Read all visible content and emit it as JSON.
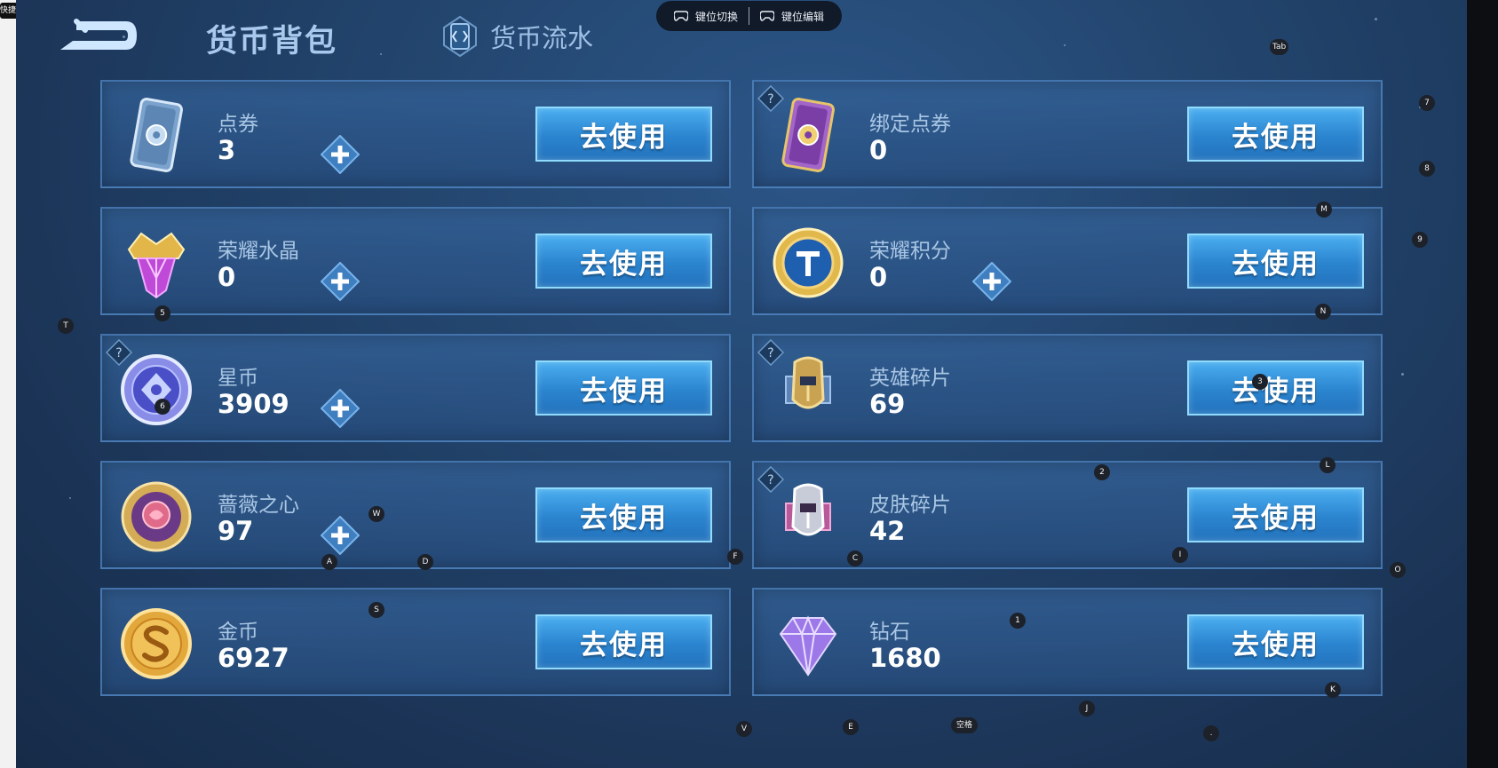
{
  "page": {
    "title": "货币背包",
    "flow_tab": "货币流水",
    "use_label": "去使用"
  },
  "toolbar": {
    "switch_label": "键位切换",
    "edit_label": "键位编辑"
  },
  "shortcut_tag": "快捷方式",
  "currencies": [
    {
      "name": "点券",
      "value": "3"
    },
    {
      "name": "绑定点券",
      "value": "0"
    },
    {
      "name": "荣耀水晶",
      "value": "0"
    },
    {
      "name": "荣耀积分",
      "value": "0"
    },
    {
      "name": "星币",
      "value": "3909"
    },
    {
      "name": "英雄碎片",
      "value": "69"
    },
    {
      "name": "蔷薇之心",
      "value": "97"
    },
    {
      "name": "皮肤碎片",
      "value": "42"
    },
    {
      "name": "金币",
      "value": "6927"
    },
    {
      "name": "钻石",
      "value": "1680"
    }
  ],
  "key_hints": [
    "Tab",
    "7",
    "8",
    "M",
    "9",
    "N",
    "T",
    "5",
    "6",
    "3",
    "2",
    "L",
    "W",
    "A",
    "D",
    "F",
    "C",
    "I",
    "O",
    "S",
    "1",
    "K",
    "J",
    "V",
    "E",
    "空格",
    "."
  ],
  "colors": {
    "background": "#23466f",
    "card": "#2e5a8e",
    "use_button": "#2b84cf",
    "plus_button": "#4a8fd0"
  }
}
